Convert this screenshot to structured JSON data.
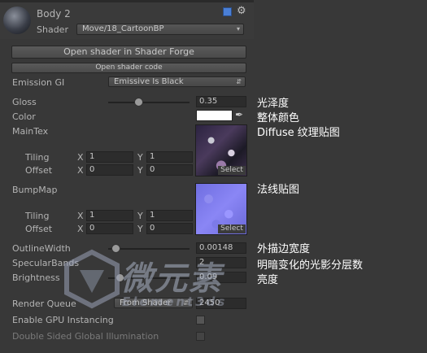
{
  "header": {
    "material_name": "Body 2",
    "shader_label": "Shader",
    "shader_value": "Move/18_CartoonBP",
    "help_icon": "help-book-icon",
    "settings_icon": "gear-icon"
  },
  "buttons": {
    "open_forge": "Open shader in Shader Forge",
    "open_code": "Open shader code"
  },
  "emission_gi": {
    "label": "Emission GI",
    "value": "Emissive Is Black"
  },
  "gloss": {
    "label": "Gloss",
    "value": "0.35",
    "annotation": "光泽度"
  },
  "color": {
    "label": "Color",
    "swatch": "#ffffff",
    "annotation": "整体颜色"
  },
  "maintex": {
    "label": "MainTex",
    "annotation": "Diffuse 纹理贴图",
    "tiling_label": "Tiling",
    "offset_label": "Offset",
    "x": "X",
    "y": "Y",
    "tiling_x": "1",
    "tiling_y": "1",
    "offset_x": "0",
    "offset_y": "0",
    "select": "Select"
  },
  "bumpmap": {
    "label": "BumpMap",
    "annotation": "法线贴图",
    "tiling_label": "Tiling",
    "offset_label": "Offset",
    "x": "X",
    "y": "Y",
    "tiling_x": "1",
    "tiling_y": "1",
    "offset_x": "0",
    "offset_y": "0",
    "select": "Select"
  },
  "outline": {
    "label": "OutlineWidth",
    "value": "0.00148",
    "annotation": "外描边宽度"
  },
  "specular": {
    "label": "SpecularBands",
    "value": "2",
    "annotation": "明暗变化的光影分层数"
  },
  "brightness": {
    "label": "Brightness",
    "value": "0.09",
    "annotation": "亮度"
  },
  "render_queue": {
    "label": "Render Queue",
    "mode": "From Shader",
    "value": "2450"
  },
  "gpu_instancing": {
    "label": "Enable GPU Instancing"
  },
  "double_sided": {
    "label": "Double Sided Global Illumination"
  },
  "watermark": {
    "logo_text": "微元素",
    "sub_text": "Element3ds"
  }
}
